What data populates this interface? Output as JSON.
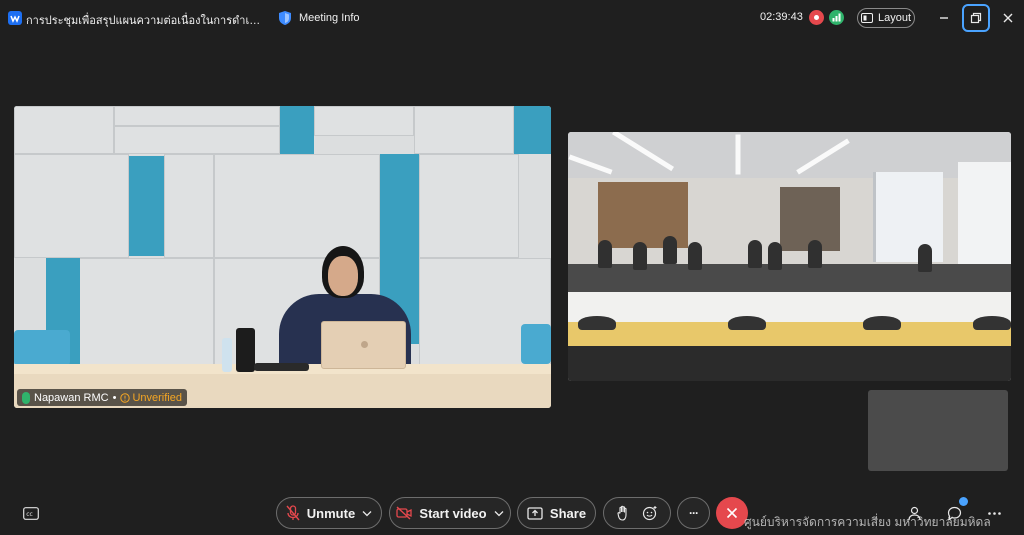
{
  "window": {
    "meeting_title": "การประชุมเพื่อสรุปแผนความต่อเนื่องในการดำเนินงานแล...",
    "meeting_info_label": "Meeting Info",
    "timer": "02:39:43",
    "layout_label": "Layout"
  },
  "main_video": {
    "participant_name": "Napawan RMC",
    "separator": "•",
    "verification_status": "Unverified"
  },
  "toolbar": {
    "unmute_label": "Unmute",
    "start_video_label": "Start video",
    "share_label": "Share",
    "more_label": "···"
  },
  "watermark": "ศูนย์บริหารจัดการความเสี่ยง มหาวิทยาลัยมหิดล",
  "colors": {
    "background": "#1f1f1f",
    "leave_red": "#e5484d",
    "accent_blue": "#4aa3ff",
    "mic_green": "#2fb36b",
    "unverified_orange": "#f5a623"
  },
  "icons": [
    "webex-logo-icon",
    "shield-icon",
    "recording-icon",
    "network-stats-icon",
    "layout-icon",
    "minimize-icon",
    "restore-icon",
    "close-icon",
    "captions-icon",
    "mic-muted-icon",
    "chevron-down-icon",
    "video-off-icon",
    "share-screen-icon",
    "raise-hand-icon",
    "reaction-icon",
    "more-icon",
    "leave-icon",
    "participants-icon",
    "chat-icon",
    "more-options-icon"
  ]
}
